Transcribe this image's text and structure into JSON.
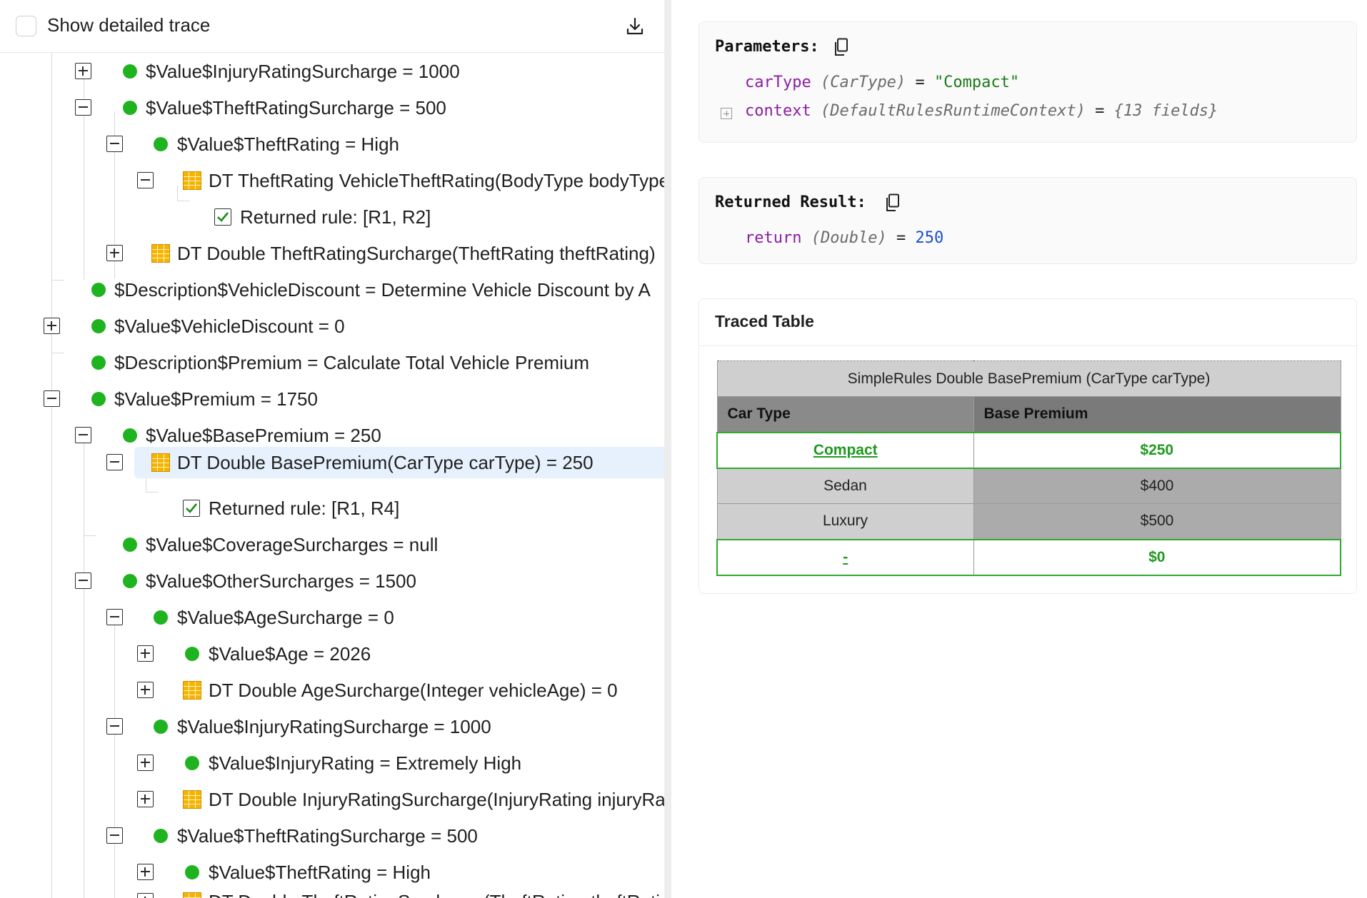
{
  "header": {
    "show_trace_label": "Show detailed trace",
    "download_icon": "download-icon"
  },
  "tree": {
    "rows": [
      {
        "label": "$Value$InjuryRatingSurcharge = 1000",
        "icon": "dot",
        "toggle": "plus"
      },
      {
        "label": "$Value$TheftRatingSurcharge = 500",
        "icon": "dot",
        "toggle": "minus"
      },
      {
        "label": "$Value$TheftRating = High",
        "icon": "dot",
        "toggle": "minus"
      },
      {
        "label": "DT TheftRating VehicleTheftRating(BodyType bodyType",
        "icon": "table",
        "toggle": "minus"
      },
      {
        "label": "Returned rule: [R1, R2]",
        "icon": "check",
        "toggle": "none"
      },
      {
        "label": "DT Double TheftRatingSurcharge(TheftRating theftRating)",
        "icon": "table",
        "toggle": "plus"
      },
      {
        "label": "$Description$VehicleDiscount = Determine Vehicle Discount by A",
        "icon": "dot",
        "toggle": "none"
      },
      {
        "label": "$Value$VehicleDiscount = 0",
        "icon": "dot",
        "toggle": "plus"
      },
      {
        "label": "$Description$Premium = Calculate Total Vehicle Premium",
        "icon": "dot",
        "toggle": "none"
      },
      {
        "label": "$Value$Premium = 1750",
        "icon": "dot",
        "toggle": "minus"
      },
      {
        "label": "$Value$BasePremium = 250",
        "icon": "dot",
        "toggle": "minus"
      },
      {
        "label": "DT Double BasePremium(CarType carType) = 250",
        "icon": "table",
        "toggle": "minus",
        "selected": true
      },
      {
        "label": "Returned rule: [R1, R4]",
        "icon": "check",
        "toggle": "none"
      },
      {
        "label": "$Value$CoverageSurcharges = null",
        "icon": "dot",
        "toggle": "none"
      },
      {
        "label": "$Value$OtherSurcharges = 1500",
        "icon": "dot",
        "toggle": "minus"
      },
      {
        "label": "$Value$AgeSurcharge = 0",
        "icon": "dot",
        "toggle": "minus"
      },
      {
        "label": "$Value$Age = 2026",
        "icon": "dot",
        "toggle": "plus"
      },
      {
        "label": "DT Double AgeSurcharge(Integer vehicleAge) = 0",
        "icon": "table",
        "toggle": "plus"
      },
      {
        "label": "$Value$InjuryRatingSurcharge = 1000",
        "icon": "dot",
        "toggle": "minus"
      },
      {
        "label": "$Value$InjuryRating = Extremely High",
        "icon": "dot",
        "toggle": "plus"
      },
      {
        "label": "DT Double InjuryRatingSurcharge(InjuryRating injuryRa",
        "icon": "table",
        "toggle": "plus"
      },
      {
        "label": "$Value$TheftRatingSurcharge = 500",
        "icon": "dot",
        "toggle": "minus"
      },
      {
        "label": "$Value$TheftRating = High",
        "icon": "dot",
        "toggle": "plus"
      },
      {
        "label": "DT Double TheftRatingSurcharge(TheftRating theftRati",
        "icon": "table",
        "toggle": "plus"
      }
    ]
  },
  "parameters": {
    "title": "Parameters:",
    "items": [
      {
        "name": "carType",
        "type": "(CarType)",
        "eq": "=",
        "value": "\"Compact\""
      },
      {
        "name": "context",
        "type": "(DefaultRulesRuntimeContext)",
        "eq": "=",
        "value": "{13 fields}"
      }
    ]
  },
  "result": {
    "title": "Returned Result:",
    "name": "return",
    "type": "(Double)",
    "eq": "=",
    "value": "250"
  },
  "traced": {
    "title": "Traced Table",
    "caption": "SimpleRules Double BasePremium (CarType carType)",
    "headers": [
      "Car Type",
      "Base Premium"
    ],
    "rows": [
      {
        "car_type": "Compact",
        "premium": "$250",
        "hit": true
      },
      {
        "car_type": "Sedan",
        "premium": "$400",
        "hit": false
      },
      {
        "car_type": "Luxury",
        "premium": "$500",
        "hit": false
      },
      {
        "car_type": "-",
        "premium": "$0",
        "hit": true
      }
    ]
  },
  "colors": {
    "dot": "#1fb31f",
    "selected_bg": "#e6f1fd",
    "hit_border": "#2eaa2e",
    "keyword": "#8a1ea0",
    "string": "#1a7a1a",
    "number": "#1a4fd0"
  }
}
